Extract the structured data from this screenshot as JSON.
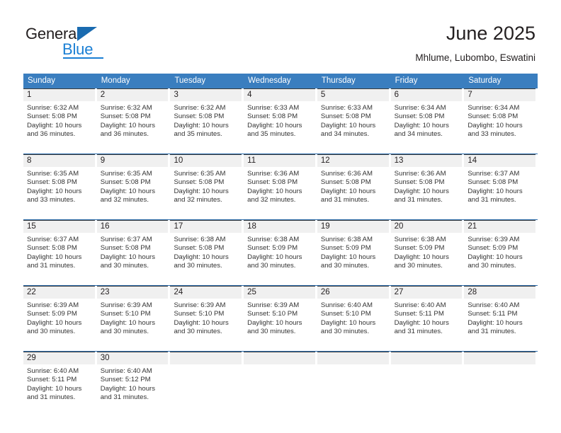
{
  "brand": {
    "name_part1": "General",
    "name_part2": "Blue",
    "accent_color": "#1a7fd4",
    "triangle_color": "#1a6bb0"
  },
  "header": {
    "title": "June 2025",
    "subtitle": "Mhlume, Lubombo, Eswatini"
  },
  "calendar": {
    "header_bg": "#3a7ebf",
    "weekdays": [
      "Sunday",
      "Monday",
      "Tuesday",
      "Wednesday",
      "Thursday",
      "Friday",
      "Saturday"
    ],
    "weeks": [
      [
        {
          "day": "1",
          "sunrise": "Sunrise: 6:32 AM",
          "sunset": "Sunset: 5:08 PM",
          "daylight1": "Daylight: 10 hours",
          "daylight2": "and 36 minutes."
        },
        {
          "day": "2",
          "sunrise": "Sunrise: 6:32 AM",
          "sunset": "Sunset: 5:08 PM",
          "daylight1": "Daylight: 10 hours",
          "daylight2": "and 36 minutes."
        },
        {
          "day": "3",
          "sunrise": "Sunrise: 6:32 AM",
          "sunset": "Sunset: 5:08 PM",
          "daylight1": "Daylight: 10 hours",
          "daylight2": "and 35 minutes."
        },
        {
          "day": "4",
          "sunrise": "Sunrise: 6:33 AM",
          "sunset": "Sunset: 5:08 PM",
          "daylight1": "Daylight: 10 hours",
          "daylight2": "and 35 minutes."
        },
        {
          "day": "5",
          "sunrise": "Sunrise: 6:33 AM",
          "sunset": "Sunset: 5:08 PM",
          "daylight1": "Daylight: 10 hours",
          "daylight2": "and 34 minutes."
        },
        {
          "day": "6",
          "sunrise": "Sunrise: 6:34 AM",
          "sunset": "Sunset: 5:08 PM",
          "daylight1": "Daylight: 10 hours",
          "daylight2": "and 34 minutes."
        },
        {
          "day": "7",
          "sunrise": "Sunrise: 6:34 AM",
          "sunset": "Sunset: 5:08 PM",
          "daylight1": "Daylight: 10 hours",
          "daylight2": "and 33 minutes."
        }
      ],
      [
        {
          "day": "8",
          "sunrise": "Sunrise: 6:35 AM",
          "sunset": "Sunset: 5:08 PM",
          "daylight1": "Daylight: 10 hours",
          "daylight2": "and 33 minutes."
        },
        {
          "day": "9",
          "sunrise": "Sunrise: 6:35 AM",
          "sunset": "Sunset: 5:08 PM",
          "daylight1": "Daylight: 10 hours",
          "daylight2": "and 32 minutes."
        },
        {
          "day": "10",
          "sunrise": "Sunrise: 6:35 AM",
          "sunset": "Sunset: 5:08 PM",
          "daylight1": "Daylight: 10 hours",
          "daylight2": "and 32 minutes."
        },
        {
          "day": "11",
          "sunrise": "Sunrise: 6:36 AM",
          "sunset": "Sunset: 5:08 PM",
          "daylight1": "Daylight: 10 hours",
          "daylight2": "and 32 minutes."
        },
        {
          "day": "12",
          "sunrise": "Sunrise: 6:36 AM",
          "sunset": "Sunset: 5:08 PM",
          "daylight1": "Daylight: 10 hours",
          "daylight2": "and 31 minutes."
        },
        {
          "day": "13",
          "sunrise": "Sunrise: 6:36 AM",
          "sunset": "Sunset: 5:08 PM",
          "daylight1": "Daylight: 10 hours",
          "daylight2": "and 31 minutes."
        },
        {
          "day": "14",
          "sunrise": "Sunrise: 6:37 AM",
          "sunset": "Sunset: 5:08 PM",
          "daylight1": "Daylight: 10 hours",
          "daylight2": "and 31 minutes."
        }
      ],
      [
        {
          "day": "15",
          "sunrise": "Sunrise: 6:37 AM",
          "sunset": "Sunset: 5:08 PM",
          "daylight1": "Daylight: 10 hours",
          "daylight2": "and 31 minutes."
        },
        {
          "day": "16",
          "sunrise": "Sunrise: 6:37 AM",
          "sunset": "Sunset: 5:08 PM",
          "daylight1": "Daylight: 10 hours",
          "daylight2": "and 30 minutes."
        },
        {
          "day": "17",
          "sunrise": "Sunrise: 6:38 AM",
          "sunset": "Sunset: 5:08 PM",
          "daylight1": "Daylight: 10 hours",
          "daylight2": "and 30 minutes."
        },
        {
          "day": "18",
          "sunrise": "Sunrise: 6:38 AM",
          "sunset": "Sunset: 5:09 PM",
          "daylight1": "Daylight: 10 hours",
          "daylight2": "and 30 minutes."
        },
        {
          "day": "19",
          "sunrise": "Sunrise: 6:38 AM",
          "sunset": "Sunset: 5:09 PM",
          "daylight1": "Daylight: 10 hours",
          "daylight2": "and 30 minutes."
        },
        {
          "day": "20",
          "sunrise": "Sunrise: 6:38 AM",
          "sunset": "Sunset: 5:09 PM",
          "daylight1": "Daylight: 10 hours",
          "daylight2": "and 30 minutes."
        },
        {
          "day": "21",
          "sunrise": "Sunrise: 6:39 AM",
          "sunset": "Sunset: 5:09 PM",
          "daylight1": "Daylight: 10 hours",
          "daylight2": "and 30 minutes."
        }
      ],
      [
        {
          "day": "22",
          "sunrise": "Sunrise: 6:39 AM",
          "sunset": "Sunset: 5:09 PM",
          "daylight1": "Daylight: 10 hours",
          "daylight2": "and 30 minutes."
        },
        {
          "day": "23",
          "sunrise": "Sunrise: 6:39 AM",
          "sunset": "Sunset: 5:10 PM",
          "daylight1": "Daylight: 10 hours",
          "daylight2": "and 30 minutes."
        },
        {
          "day": "24",
          "sunrise": "Sunrise: 6:39 AM",
          "sunset": "Sunset: 5:10 PM",
          "daylight1": "Daylight: 10 hours",
          "daylight2": "and 30 minutes."
        },
        {
          "day": "25",
          "sunrise": "Sunrise: 6:39 AM",
          "sunset": "Sunset: 5:10 PM",
          "daylight1": "Daylight: 10 hours",
          "daylight2": "and 30 minutes."
        },
        {
          "day": "26",
          "sunrise": "Sunrise: 6:40 AM",
          "sunset": "Sunset: 5:10 PM",
          "daylight1": "Daylight: 10 hours",
          "daylight2": "and 30 minutes."
        },
        {
          "day": "27",
          "sunrise": "Sunrise: 6:40 AM",
          "sunset": "Sunset: 5:11 PM",
          "daylight1": "Daylight: 10 hours",
          "daylight2": "and 31 minutes."
        },
        {
          "day": "28",
          "sunrise": "Sunrise: 6:40 AM",
          "sunset": "Sunset: 5:11 PM",
          "daylight1": "Daylight: 10 hours",
          "daylight2": "and 31 minutes."
        }
      ],
      [
        {
          "day": "29",
          "sunrise": "Sunrise: 6:40 AM",
          "sunset": "Sunset: 5:11 PM",
          "daylight1": "Daylight: 10 hours",
          "daylight2": "and 31 minutes."
        },
        {
          "day": "30",
          "sunrise": "Sunrise: 6:40 AM",
          "sunset": "Sunset: 5:12 PM",
          "daylight1": "Daylight: 10 hours",
          "daylight2": "and 31 minutes."
        },
        {
          "day": "",
          "sunrise": "",
          "sunset": "",
          "daylight1": "",
          "daylight2": ""
        },
        {
          "day": "",
          "sunrise": "",
          "sunset": "",
          "daylight1": "",
          "daylight2": ""
        },
        {
          "day": "",
          "sunrise": "",
          "sunset": "",
          "daylight1": "",
          "daylight2": ""
        },
        {
          "day": "",
          "sunrise": "",
          "sunset": "",
          "daylight1": "",
          "daylight2": ""
        },
        {
          "day": "",
          "sunrise": "",
          "sunset": "",
          "daylight1": "",
          "daylight2": ""
        }
      ]
    ]
  }
}
